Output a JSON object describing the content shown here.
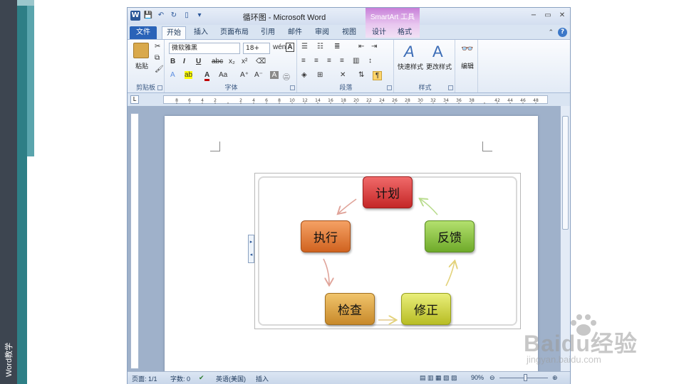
{
  "side_label": "Word教学",
  "window": {
    "title": "循环图 - Microsoft Word",
    "contextual_tools": "SmartArt 工具",
    "controls": [
      "−",
      "▭",
      "✕"
    ]
  },
  "tabs": [
    "文件",
    "开始",
    "插入",
    "页面布局",
    "引用",
    "邮件",
    "审阅",
    "视图",
    "设计",
    "格式"
  ],
  "ribbon": {
    "clipboard": {
      "paste": "粘贴",
      "label": "剪贴板"
    },
    "font": {
      "name": "微软雅黑",
      "size": "18+",
      "label": "字体",
      "bold": "B",
      "italic": "I",
      "underline": "U"
    },
    "paragraph": {
      "label": "段落"
    },
    "styles": {
      "quick": "快速样式",
      "change": "更改样式",
      "label": "样式"
    },
    "editing": {
      "label": "编辑"
    }
  },
  "ruler_ticks": [
    "8",
    "6",
    "4",
    "2",
    "",
    "2",
    "4",
    "6",
    "8",
    "10",
    "12",
    "14",
    "16",
    "18",
    "20",
    "22",
    "24",
    "26",
    "28",
    "30",
    "32",
    "34",
    "36",
    "38",
    "",
    "42",
    "44",
    "46",
    "48"
  ],
  "smartart": {
    "nodes": [
      "计划",
      "反馈",
      "修正",
      "检查",
      "执行"
    ],
    "colors": {
      "plan": "#d93a3a",
      "feedback": "#8cc63e",
      "fix": "#c9d13a",
      "check": "#d9a339",
      "execute": "#e07a30",
      "arrow": "#e0a49a"
    }
  },
  "statusbar": {
    "page": "页面: 1/1",
    "words": "字数: 0",
    "language": "英语(美国)",
    "mode": "插入",
    "zoom": "90%"
  },
  "watermark": {
    "brand": "Baidu经验",
    "url": "jingyan.baidu.com"
  }
}
